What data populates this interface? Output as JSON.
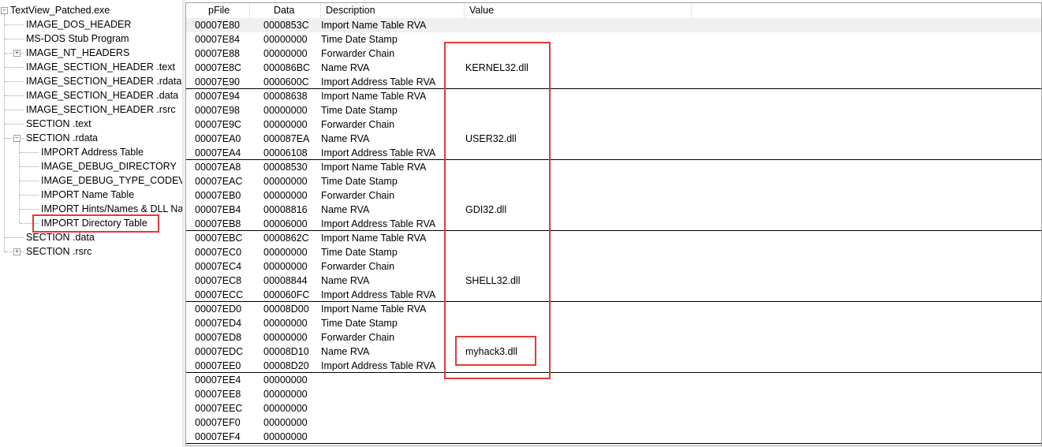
{
  "tree": {
    "root": "TextView_Patched.exe",
    "items": [
      {
        "label": "IMAGE_DOS_HEADER",
        "level": 1,
        "expander": null
      },
      {
        "label": "MS-DOS Stub Program",
        "level": 1,
        "expander": null
      },
      {
        "label": "IMAGE_NT_HEADERS",
        "level": 1,
        "expander": "+"
      },
      {
        "label": "IMAGE_SECTION_HEADER .text",
        "level": 1,
        "expander": null
      },
      {
        "label": "IMAGE_SECTION_HEADER .rdata",
        "level": 1,
        "expander": null
      },
      {
        "label": "IMAGE_SECTION_HEADER .data",
        "level": 1,
        "expander": null
      },
      {
        "label": "IMAGE_SECTION_HEADER .rsrc",
        "level": 1,
        "expander": null
      },
      {
        "label": "SECTION .text",
        "level": 1,
        "expander": null
      },
      {
        "label": "SECTION .rdata",
        "level": 1,
        "expander": "-"
      },
      {
        "label": "IMPORT Address Table",
        "level": 2,
        "expander": null
      },
      {
        "label": "IMAGE_DEBUG_DIRECTORY",
        "level": 2,
        "expander": null
      },
      {
        "label": "IMAGE_DEBUG_TYPE_CODEVIEW",
        "level": 2,
        "expander": null
      },
      {
        "label": "IMPORT Name Table",
        "level": 2,
        "expander": null
      },
      {
        "label": "IMPORT Hints/Names & DLL Names",
        "level": 2,
        "expander": null
      },
      {
        "label": "IMPORT Directory Table",
        "level": 2,
        "expander": null,
        "selected": true
      },
      {
        "label": "SECTION .data",
        "level": 1,
        "expander": null
      },
      {
        "label": "SECTION .rsrc",
        "level": 1,
        "expander": "+"
      }
    ]
  },
  "list": {
    "columns": [
      "pFile",
      "Data",
      "Description",
      "Value"
    ],
    "rows": [
      {
        "pfile": "00007E80",
        "data": "0000853C",
        "desc": "Import Name Table RVA",
        "value": ""
      },
      {
        "pfile": "00007E84",
        "data": "00000000",
        "desc": "Time Date Stamp",
        "value": ""
      },
      {
        "pfile": "00007E88",
        "data": "00000000",
        "desc": "Forwarder Chain",
        "value": ""
      },
      {
        "pfile": "00007E8C",
        "data": "000086BC",
        "desc": "Name RVA",
        "value": "KERNEL32.dll"
      },
      {
        "pfile": "00007E90",
        "data": "0000600C",
        "desc": "Import Address Table RVA",
        "value": ""
      },
      {
        "pfile": "00007E94",
        "data": "00008638",
        "desc": "Import Name Table RVA",
        "value": ""
      },
      {
        "pfile": "00007E98",
        "data": "00000000",
        "desc": "Time Date Stamp",
        "value": ""
      },
      {
        "pfile": "00007E9C",
        "data": "00000000",
        "desc": "Forwarder Chain",
        "value": ""
      },
      {
        "pfile": "00007EA0",
        "data": "000087EA",
        "desc": "Name RVA",
        "value": "USER32.dll"
      },
      {
        "pfile": "00007EA4",
        "data": "00006108",
        "desc": "Import Address Table RVA",
        "value": ""
      },
      {
        "pfile": "00007EA8",
        "data": "00008530",
        "desc": "Import Name Table RVA",
        "value": ""
      },
      {
        "pfile": "00007EAC",
        "data": "00000000",
        "desc": "Time Date Stamp",
        "value": ""
      },
      {
        "pfile": "00007EB0",
        "data": "00000000",
        "desc": "Forwarder Chain",
        "value": ""
      },
      {
        "pfile": "00007EB4",
        "data": "00008816",
        "desc": "Name RVA",
        "value": "GDI32.dll"
      },
      {
        "pfile": "00007EB8",
        "data": "00006000",
        "desc": "Import Address Table RVA",
        "value": ""
      },
      {
        "pfile": "00007EBC",
        "data": "0000862C",
        "desc": "Import Name Table RVA",
        "value": ""
      },
      {
        "pfile": "00007EC0",
        "data": "00000000",
        "desc": "Time Date Stamp",
        "value": ""
      },
      {
        "pfile": "00007EC4",
        "data": "00000000",
        "desc": "Forwarder Chain",
        "value": ""
      },
      {
        "pfile": "00007EC8",
        "data": "00008844",
        "desc": "Name RVA",
        "value": "SHELL32.dll"
      },
      {
        "pfile": "00007ECC",
        "data": "000060FC",
        "desc": "Import Address Table RVA",
        "value": ""
      },
      {
        "pfile": "00007ED0",
        "data": "00008D00",
        "desc": "Import Name Table RVA",
        "value": ""
      },
      {
        "pfile": "00007ED4",
        "data": "00000000",
        "desc": "Time Date Stamp",
        "value": ""
      },
      {
        "pfile": "00007ED8",
        "data": "00000000",
        "desc": "Forwarder Chain",
        "value": ""
      },
      {
        "pfile": "00007EDC",
        "data": "00008D10",
        "desc": "Name RVA",
        "value": "myhack3.dll"
      },
      {
        "pfile": "00007EE0",
        "data": "00008D20",
        "desc": "Import Address Table RVA",
        "value": ""
      },
      {
        "pfile": "00007EE4",
        "data": "00000000",
        "desc": "",
        "value": ""
      },
      {
        "pfile": "00007EE8",
        "data": "00000000",
        "desc": "",
        "value": ""
      },
      {
        "pfile": "00007EEC",
        "data": "00000000",
        "desc": "",
        "value": ""
      },
      {
        "pfile": "00007EF0",
        "data": "00000000",
        "desc": "",
        "value": ""
      },
      {
        "pfile": "00007EF4",
        "data": "00000000",
        "desc": "",
        "value": ""
      }
    ]
  },
  "colors": {
    "highlight": "#e53935",
    "selected_row": "#f0f0f0",
    "grid": "#e5e5e5"
  }
}
